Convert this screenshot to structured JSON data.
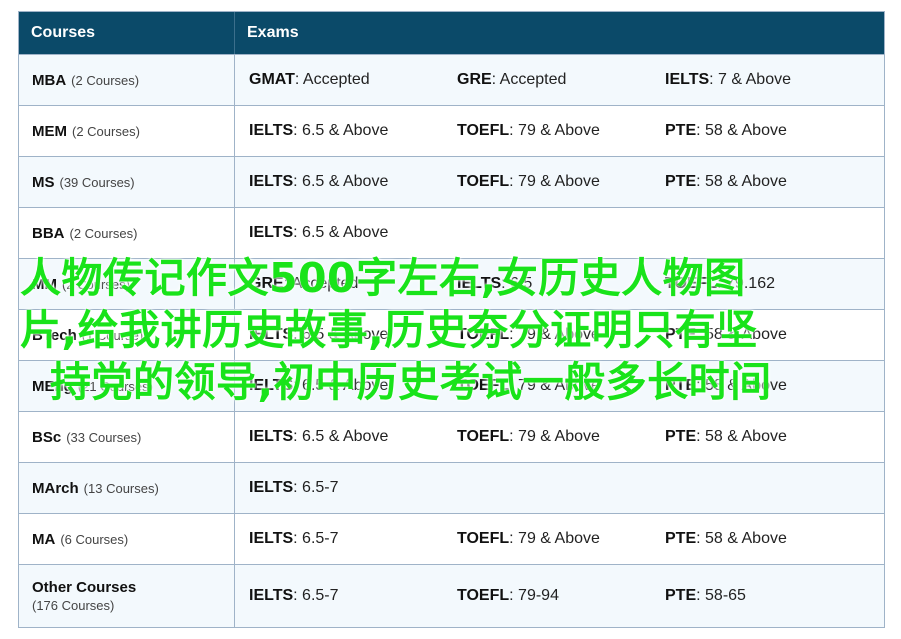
{
  "header": {
    "courses": "Courses",
    "exams": "Exams"
  },
  "rows": [
    {
      "name": "MBA",
      "count": "(2 Courses)",
      "exams": [
        {
          "name": "GMAT",
          "value": ": Accepted"
        },
        {
          "name": "GRE",
          "value": ": Accepted"
        },
        {
          "name": "IELTS",
          "value": ": 7 & Above"
        }
      ]
    },
    {
      "name": "MEM",
      "count": "(2 Courses)",
      "exams": [
        {
          "name": "IELTS",
          "value": ": 6.5 & Above"
        },
        {
          "name": "TOEFL",
          "value": ": 79 & Above"
        },
        {
          "name": "PTE",
          "value": ": 58 & Above"
        }
      ]
    },
    {
      "name": "MS",
      "count": "(39 Courses)",
      "exams": [
        {
          "name": "IELTS",
          "value": ": 6.5 & Above"
        },
        {
          "name": "TOEFL",
          "value": ": 79 & Above"
        },
        {
          "name": "PTE",
          "value": ": 58 & Above"
        }
      ]
    },
    {
      "name": "BBA",
      "count": "(2 Courses)",
      "exams": [
        {
          "name": "IELTS",
          "value": ": 6.5 & Above"
        }
      ]
    },
    {
      "name": "MM",
      "count": "(2 Courses)",
      "exams": [
        {
          "name": "GRE",
          "value": ": Accepted"
        },
        {
          "name": "IELTS",
          "value": ": 6.5"
        },
        {
          "name": "TOEFL",
          "value": ": 79.162"
        }
      ]
    },
    {
      "name": "BTech",
      "count": "(1 Course)",
      "exams": [
        {
          "name": "IELTS",
          "value": ": 6.5 & Above"
        },
        {
          "name": "TOEFL",
          "value": ": 79 & Above"
        },
        {
          "name": "PTE",
          "value": ": 58 & Above"
        }
      ]
    },
    {
      "name": "MEng",
      "count": "(21 Courses)",
      "exams": [
        {
          "name": "IELTS",
          "value": ": 6.5 & Above"
        },
        {
          "name": "TOEFL",
          "value": ": 79 & Above"
        },
        {
          "name": "PTE",
          "value": ": 58 & Above"
        }
      ]
    },
    {
      "name": "BSc",
      "count": "(33 Courses)",
      "exams": [
        {
          "name": "IELTS",
          "value": ": 6.5 & Above"
        },
        {
          "name": "TOEFL",
          "value": ": 79 & Above"
        },
        {
          "name": "PTE",
          "value": ": 58 & Above"
        }
      ]
    },
    {
      "name": "MArch",
      "count": "(13 Courses)",
      "exams": [
        {
          "name": "IELTS",
          "value": ": 6.5-7"
        }
      ]
    },
    {
      "name": "MA",
      "count": "(6 Courses)",
      "exams": [
        {
          "name": "IELTS",
          "value": ": 6.5-7"
        },
        {
          "name": "TOEFL",
          "value": ": 79 & Above"
        },
        {
          "name": "PTE",
          "value": ": 58 & Above"
        }
      ]
    },
    {
      "name": "Other Courses",
      "count": "(176 Courses)",
      "exams": [
        {
          "name": "IELTS",
          "value": ": 6.5-7"
        },
        {
          "name": "TOEFL",
          "value": ": 79-94"
        },
        {
          "name": "PTE",
          "value": ": 58-65"
        }
      ]
    }
  ],
  "overlay": {
    "line1": "人物传记作文500字左右,女历史人物图",
    "line2": "片,给我讲历史故事,历史夯分证明只有坚",
    "line3": "持党的领导,初中历史考试一般多长时间"
  }
}
